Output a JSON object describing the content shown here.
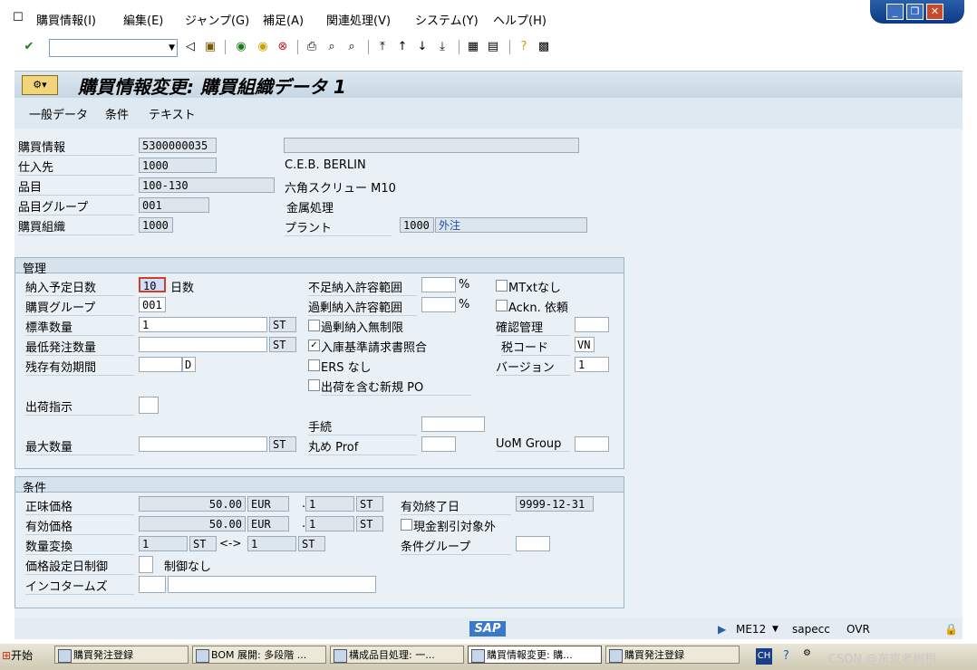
{
  "menubar": {
    "items": [
      "購買情報(I)",
      "編集(E)",
      "ジャンプ(G)",
      "補足(A)",
      "関連処理(V)",
      "システム(Y)",
      "ヘルプ(H)"
    ]
  },
  "window_controls": {
    "minimize": "_",
    "restore": "❐",
    "close": "✕"
  },
  "toolbar": {
    "command_value": ""
  },
  "title": {
    "text": "購買情報変更: 購買組織データ 1"
  },
  "subtoolbar": {
    "items": [
      "一般データ",
      "条件",
      "テキスト"
    ]
  },
  "header": {
    "info_record_label": "購買情報",
    "info_record_value": "5300000035",
    "info_record_desc": "",
    "vendor_label": "仕入先",
    "vendor_value": "1000",
    "vendor_name": "C.E.B. BERLIN",
    "material_label": "品目",
    "material_value": "100-130",
    "material_desc": "六角スクリュー M10",
    "matgroup_label": "品目グループ",
    "matgroup_value": "001",
    "matgroup_desc": "金属処理",
    "purchorg_label": "購買組織",
    "purchorg_value": "1000",
    "plant_label": "プラント",
    "plant_value": "1000",
    "plant_desc": "外注"
  },
  "management": {
    "title": "管理",
    "planned_delivery_label": "納入予定日数",
    "planned_delivery_value": "10",
    "planned_delivery_unit": "日数",
    "purch_group_label": "購買グループ",
    "purch_group_value": "001",
    "std_qty_label": "標準数量",
    "std_qty_value": "1",
    "std_qty_unit": "ST",
    "min_qty_label": "最低発注数量",
    "min_qty_value": "",
    "min_qty_unit": "ST",
    "shelf_life_label": "残存有効期間",
    "shelf_life_value": "",
    "shelf_life_unit": "D",
    "shipping_instr_label": "出荷指示",
    "shipping_instr_value": "",
    "max_qty_label": "最大数量",
    "max_qty_value": "",
    "max_qty_unit": "ST",
    "underdel_label": "不足納入許容範囲",
    "underdel_value": "",
    "pct": "%",
    "overdel_label": "過剰納入許容範囲",
    "overdel_value": "",
    "unlimited_label": "過剰納入無制限",
    "gr_iv_label": "入庫基準請求書照合",
    "ers_label": "ERS なし",
    "new_po_label": "出荷を含む新規 PO",
    "procedure_label": "手続",
    "procedure_value": "",
    "rounding_label": "丸め Prof",
    "rounding_value": "",
    "mtext_label": "MTxtなし",
    "ackn_label": "Ackn. 依頼",
    "conf_label": "確認管理",
    "conf_value": "",
    "tax_label": "税コード",
    "tax_value": "VN",
    "version_label": "バージョン",
    "version_value": "1",
    "uom_label": "UoM Group",
    "uom_value": ""
  },
  "conditions": {
    "title": "条件",
    "net_price_label": "正味価格",
    "net_price_value": "50.00",
    "net_price_curr": "EUR",
    "net_price_per": "1",
    "net_price_unit": "ST",
    "eff_price_label": "有効価格",
    "eff_price_value": "50.00",
    "eff_price_curr": "EUR",
    "eff_price_per": "1",
    "eff_price_unit": "ST",
    "qty_conv_label": "数量変換",
    "qty_conv_from": "1",
    "qty_conv_from_unit": "ST",
    "qty_conv_arrow": "<->",
    "qty_conv_to": "1",
    "qty_conv_to_unit": "ST",
    "price_date_label": "価格設定日制御",
    "price_date_value": "",
    "price_date_desc": "制御なし",
    "incoterms_label": "インコタームズ",
    "incoterms_value": "",
    "incoterms_text": "",
    "valid_to_label": "有効終了日",
    "valid_to_value": "9999-12-31",
    "no_cash_disc_label": "現金割引対象外",
    "cond_group_label": "条件グループ",
    "cond_group_value": ""
  },
  "statusbar": {
    "logo": "SAP",
    "tcode": "ME12",
    "server": "sapecc",
    "mode": "OVR"
  },
  "taskbar": {
    "start": "开始",
    "tasks": [
      "購買発注登録",
      "BOM 展開: 多段階 ...",
      "構成品目処理: 一...",
      "購買情報変更: 購...",
      "購買発注登録"
    ],
    "lang": "CH",
    "watermark": "CSDN @东京老树根"
  }
}
